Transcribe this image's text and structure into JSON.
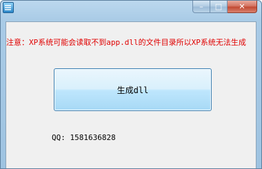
{
  "window": {
    "controls": {
      "minimize_glyph": "–",
      "maximize_glyph": "□",
      "close_glyph": "✕"
    }
  },
  "main": {
    "notice_text": "注意：XP系统可能会读取不到app.dll的文件目录所以XP系统无法生成",
    "generate_button_label": "生成dll",
    "qq_label": "QQ: 1581636828"
  },
  "colors": {
    "notice": "#e00000",
    "button_border": "#3c7fb1",
    "client_bg": "#f0f0f0"
  },
  "icons": {
    "app": "app-icon"
  }
}
